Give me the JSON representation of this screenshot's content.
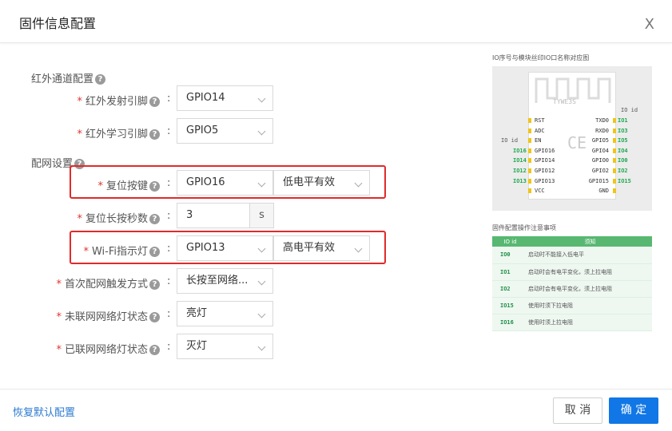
{
  "dialog": {
    "title": "固件信息配置",
    "close_glyph": "X"
  },
  "sections": {
    "ir": "红外通道配置",
    "network": "配网设置"
  },
  "fields": {
    "ir_tx": {
      "label": "红外发射引脚",
      "value": "GPIO14"
    },
    "ir_learn": {
      "label": "红外学习引脚",
      "value": "GPIO5"
    },
    "reset_key": {
      "label": "复位按键",
      "value": "GPIO16",
      "level": "低电平有效"
    },
    "reset_seconds": {
      "label": "复位长按秒数",
      "value": "3",
      "unit": "s"
    },
    "wifi_led": {
      "label": "Wi-Fi指示灯",
      "value": "GPIO13",
      "level": "高电平有效"
    },
    "first_trigger": {
      "label": "首次配网触发方式",
      "value": "长按至网络..."
    },
    "led_offline": {
      "label": "未联网网络灯状态",
      "value": "亮灯"
    },
    "led_online": {
      "label": "已联网网络灯状态",
      "value": "灭灯"
    }
  },
  "pinout_panel": {
    "caption": "IO序号与模块丝印IO口名称对应图",
    "chip_label": "TYWE3S",
    "io_id_left": "IO id",
    "io_id_right": "IO id",
    "left_pins": [
      {
        "io": "",
        "name": "RST"
      },
      {
        "io": "",
        "name": "ADC"
      },
      {
        "io": "",
        "name": "EN"
      },
      {
        "io": "IO16",
        "name": "GPIO16"
      },
      {
        "io": "IO14",
        "name": "GPIO14"
      },
      {
        "io": "IO12",
        "name": "GPIO12"
      },
      {
        "io": "IO13",
        "name": "GPIO13"
      },
      {
        "io": "",
        "name": "VCC"
      }
    ],
    "right_pins": [
      {
        "name": "TXD0",
        "io": "IO1"
      },
      {
        "name": "RXD0",
        "io": "IO3"
      },
      {
        "name": "GPIO5",
        "io": "IO5"
      },
      {
        "name": "GPIO4",
        "io": "IO4"
      },
      {
        "name": "GPIO0",
        "io": "IO0"
      },
      {
        "name": "GPIO2",
        "io": "IO2"
      },
      {
        "name": "GPIO15",
        "io": "IO15"
      },
      {
        "name": "GND",
        "io": ""
      }
    ],
    "accent_color": "#1fa84f",
    "pin_dot_color": "#f0c419"
  },
  "notes_panel": {
    "caption": "固件配置操作注意事项",
    "headers": [
      "IO id",
      "须知"
    ],
    "rows": [
      [
        "IO0",
        "启动时不能接入低电平"
      ],
      [
        "IO1",
        "启动时会有电平变化，须上拉电阻"
      ],
      [
        "IO2",
        "启动时会有电平变化，须上拉电阻"
      ],
      [
        "IO15",
        "使用时须下拉电阻"
      ],
      [
        "IO16",
        "使用时须上拉电阻"
      ]
    ],
    "header_color": "#58b872"
  },
  "footer": {
    "restore_label": "恢复默认配置",
    "cancel_label": "取 消",
    "ok_label": "确 定"
  },
  "colors": {
    "primary": "#1177e6",
    "required": "#e0342f",
    "highlight_box": "#e12a2a"
  }
}
